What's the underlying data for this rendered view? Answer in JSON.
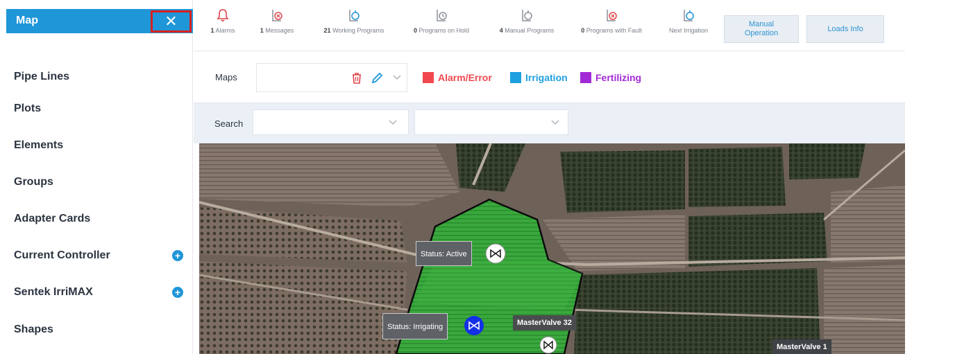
{
  "sidebar": {
    "title": "Map",
    "close_glyph": "✕",
    "items": [
      {
        "label": "Pipe Lines",
        "has_add": false
      },
      {
        "label": "Plots",
        "has_add": false
      },
      {
        "label": "Elements",
        "has_add": false
      },
      {
        "label": "Groups",
        "has_add": false
      },
      {
        "label": "Adapter Cards",
        "has_add": false
      },
      {
        "label": "Current Controller",
        "has_add": true
      },
      {
        "label": "Sentek IrriMAX",
        "has_add": true
      },
      {
        "label": "Shapes",
        "has_add": false
      }
    ],
    "add_glyph": "+"
  },
  "status_bar": {
    "items": [
      {
        "count": "1",
        "label": "Alarms",
        "icon": "bell-icon"
      },
      {
        "count": "1",
        "label": "Messages",
        "icon": "message-alert-icon"
      },
      {
        "count": "21",
        "label": "Working Programs",
        "icon": "program-working-icon"
      },
      {
        "count": "0",
        "label": "Programs on Hold",
        "icon": "program-hold-icon"
      },
      {
        "count": "4",
        "label": "Manual Programs",
        "icon": "program-manual-icon"
      },
      {
        "count": "0",
        "label": "Programs with Fault",
        "icon": "program-fault-icon"
      },
      {
        "count": "",
        "label": "Next Irrigation",
        "icon": "next-irrigation-icon"
      }
    ],
    "manual_operation_line1": "Manual",
    "manual_operation_line2": "Operation",
    "loads_info": "Loads Info"
  },
  "maps_row": {
    "label": "Maps",
    "legend": [
      {
        "label": "Alarm/Error",
        "color": "#f0484e"
      },
      {
        "label": "Irrigation",
        "color": "#1e9fe0"
      },
      {
        "label": "Fertilizing",
        "color": "#a22ad6"
      }
    ]
  },
  "search_row": {
    "label": "Search"
  },
  "map": {
    "markers": [
      {
        "label": "Status: Active",
        "state": "active"
      },
      {
        "label": "Status: Irrigating",
        "state": "irrigating"
      }
    ],
    "valves": [
      {
        "label": "MasterValve 32"
      },
      {
        "label": "MasterValve 1"
      }
    ]
  },
  "colors": {
    "accent": "#1f96d8",
    "highlight_border": "#d8201e",
    "active_plot": "#3aa83d",
    "irrigating_marker": "#1330e6",
    "alarm_icon": "#e0454a"
  }
}
